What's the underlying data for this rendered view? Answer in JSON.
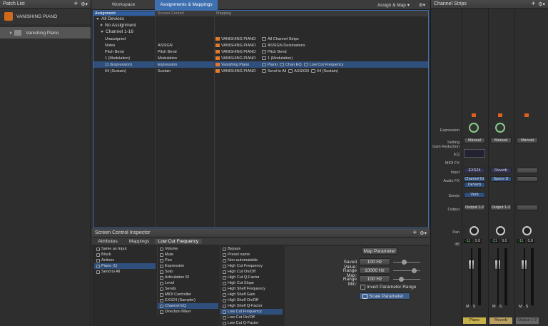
{
  "patch_list": {
    "title": "Patch List",
    "root": "VANISHING PIANO",
    "item": "Vanishing Piano"
  },
  "tabs": {
    "workspace": "Workspace",
    "assignments": "Assignments & Mappings",
    "assign_map": "Assign & Map"
  },
  "columns": {
    "assignment": "Assignment",
    "screen_control": "Screen Control",
    "mapping": "Mapping"
  },
  "tree": {
    "all_devices": "All Devices",
    "no_assignment": "No Assignment",
    "channel": "Channel 1-16"
  },
  "rows": [
    {
      "a": "Unassigned",
      "s": "",
      "m": [
        "VANISHING PIANO",
        "All Channel Strips"
      ]
    },
    {
      "a": "Notes",
      "s": "ASSIGN",
      "m": [
        "VANISHING PIANO",
        "ASSIGN Destinations"
      ]
    },
    {
      "a": "Pitch Bend",
      "s": "Pitch Bend",
      "m": [
        "VANISHING PIANO",
        "Pitch Bend"
      ]
    },
    {
      "a": "1 (Modulation)",
      "s": "Modulation",
      "m": [
        "VANISHING PIANO",
        "1 (Modulation)"
      ]
    },
    {
      "a": "11 (Expression)",
      "s": "Expression",
      "m": [
        "Vanishing Piano",
        "Piano",
        "Chan EQ",
        "Low Cut Frequency"
      ]
    },
    {
      "a": "64 (Sustain)",
      "s": "Sustain",
      "m": [
        "VANISHING PIANO",
        "Send to All",
        "ASSIGN",
        "64 (Sustain)"
      ]
    }
  ],
  "inspector": {
    "title": "Screen Control Inspector",
    "tabs": [
      "Attributes",
      "Mappings",
      "Low Cut Frequency"
    ],
    "col1": [
      "Same as Input",
      "Block",
      "Actions",
      "Piano (1)",
      "Send to All"
    ],
    "col2": [
      "Volume",
      "Mute",
      "Pan",
      "Expression",
      "Solo",
      "Articulation ID",
      "Level",
      "Sends",
      "MIDI Controller",
      "EXS24 (Sampler)",
      "Channel EQ",
      "Direction Mixer"
    ],
    "col3": [
      "Bypass",
      "Preset name",
      "Non-automatable",
      "High Cut Frequency",
      "High Cut On/Off",
      "High Cut Q-Factor",
      "High Cut Slope",
      "High Shelf Frequency",
      "High Shelf Gain",
      "High Shelf On/Off",
      "High Shelf Q-Factor",
      "Low Cut Frequency",
      "Low Cut On/Off",
      "Low Cut Q-Factor"
    ],
    "map_param": "Map Parameter",
    "saved_label": "Saved Value:",
    "saved": "100 Hz",
    "max_label": "Range Max:",
    "max": "10000 Hz",
    "min_label": "Range Min:",
    "min": "100 Hz",
    "invert": "Invert Parameter Range",
    "scale": "Scale Parameter"
  },
  "strips": {
    "title": "Channel Strips",
    "labels": {
      "expression": "Expression",
      "setting": "Setting",
      "gain": "Gain Reduction",
      "eq": "EQ",
      "midi": "MIDI FX",
      "input": "Input",
      "audio": "Audio FX",
      "sends": "Sends",
      "output": "Output",
      "pan": "Pan",
      "db": "dB"
    },
    "ch": [
      {
        "setting": "Manual",
        "input": "EXS24",
        "fx1": "Channel EQ",
        "fx2": "DeVerb",
        "send": "Verb",
        "output": "Output 1-2",
        "db1": "-11",
        "db2": "0.0",
        "name": "Piano",
        "color": "#c8b04a"
      },
      {
        "setting": "Manual",
        "input": "Reverb",
        "fx1": "Space D",
        "fx2": "",
        "send": "",
        "output": "Output 1-2",
        "db1": "-21",
        "db2": "0.0",
        "name": "Reverb",
        "color": "#b9a060"
      },
      {
        "setting": "Manual",
        "input": "",
        "fx1": "",
        "fx2": "",
        "send": "",
        "output": "",
        "db1": "-11",
        "db2": "0.0",
        "name": "Output 1-2",
        "color": "#666"
      }
    ]
  }
}
